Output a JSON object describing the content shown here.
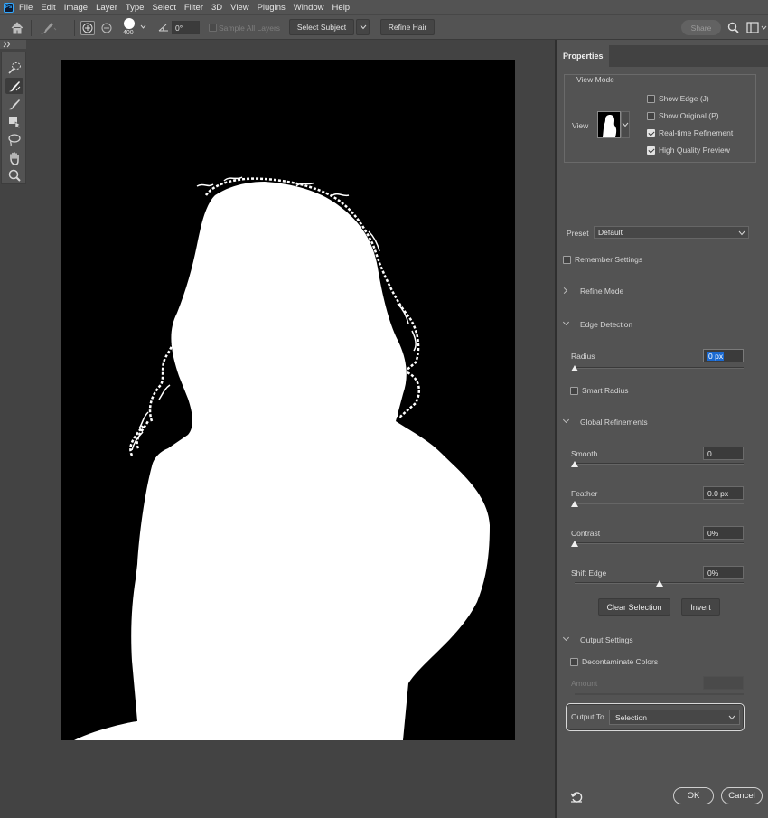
{
  "app": {
    "logo_text": "Ps"
  },
  "menu": [
    "File",
    "Edit",
    "Image",
    "Layer",
    "Type",
    "Select",
    "Filter",
    "3D",
    "View",
    "Plugins",
    "Window",
    "Help"
  ],
  "options_bar": {
    "brush_size": "400",
    "angle": "0°",
    "sample_all_layers": "Sample All Layers",
    "select_subject": "Select Subject",
    "refine_hair": "Refine Hair",
    "share": "Share"
  },
  "tools": [
    "quick-selection-icon",
    "refine-edge-brush-icon",
    "brush-icon",
    "object-selection-icon",
    "lasso-icon",
    "hand-icon",
    "zoom-icon"
  ],
  "properties": {
    "tab": "Properties",
    "view_mode": {
      "title": "View Mode",
      "view_label": "View",
      "show_edge": {
        "label": "Show Edge (J)",
        "checked": false
      },
      "show_original": {
        "label": "Show Original (P)",
        "checked": false
      },
      "realtime_refinement": {
        "label": "Real-time Refinement",
        "checked": true
      },
      "high_quality_preview": {
        "label": "High Quality Preview",
        "checked": true
      }
    },
    "preset": {
      "label": "Preset",
      "value": "Default"
    },
    "remember_settings": {
      "label": "Remember Settings",
      "checked": false
    },
    "refine_mode": "Refine Mode",
    "edge_detection": {
      "title": "Edge Detection",
      "radius_label": "Radius",
      "radius_value": "0 px",
      "radius_level": 0,
      "smart_radius": {
        "label": "Smart Radius",
        "checked": false
      }
    },
    "global_refinements": {
      "title": "Global Refinements",
      "smooth": {
        "label": "Smooth",
        "value": "0",
        "level": 0
      },
      "feather": {
        "label": "Feather",
        "value": "0.0 px",
        "level": 0
      },
      "contrast": {
        "label": "Contrast",
        "value": "0%",
        "level": 0
      },
      "shift_edge": {
        "label": "Shift Edge",
        "value": "0%",
        "level": 0.5
      }
    },
    "clear_selection": "Clear Selection",
    "invert": "Invert",
    "output_settings": {
      "title": "Output Settings",
      "decontaminate": {
        "label": "Decontaminate Colors",
        "checked": false
      },
      "amount_label": "Amount",
      "output_to_label": "Output To",
      "output_to_value": "Selection"
    },
    "ok": "OK",
    "cancel": "Cancel"
  }
}
